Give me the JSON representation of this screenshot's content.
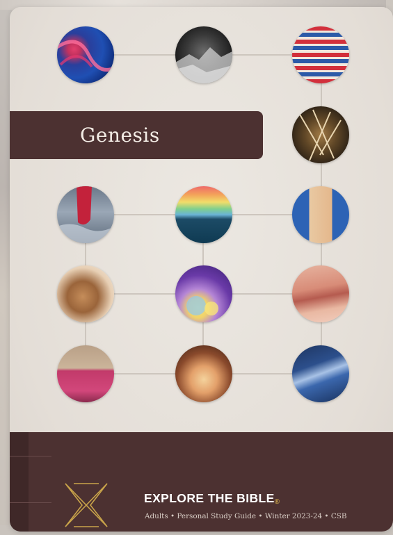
{
  "cover": {
    "title": "Genesis",
    "brand": "EXPLORE THE BIBLE",
    "brand_mark": "®",
    "subtitle": "Adults • Personal Study Guide • Winter 2023-24 • CSB"
  },
  "photos": [
    {
      "name": "photo-blue-fabric"
    },
    {
      "name": "photo-rocky-shore"
    },
    {
      "name": "photo-woven-textile"
    },
    {
      "name": "photo-dry-grass"
    },
    {
      "name": "photo-red-cloth-water"
    },
    {
      "name": "photo-rainbow-sea"
    },
    {
      "name": "photo-ballet-feet"
    },
    {
      "name": "photo-clay-hands"
    },
    {
      "name": "photo-purple-petals"
    },
    {
      "name": "photo-lips-closeup"
    },
    {
      "name": "photo-pink-ribbons"
    },
    {
      "name": "photo-sunset-trees"
    },
    {
      "name": "photo-blue-waves"
    }
  ],
  "colors": {
    "banner": "#4c3131",
    "paper": "#e8e3dc",
    "accent_gold": "#c9a44a"
  }
}
